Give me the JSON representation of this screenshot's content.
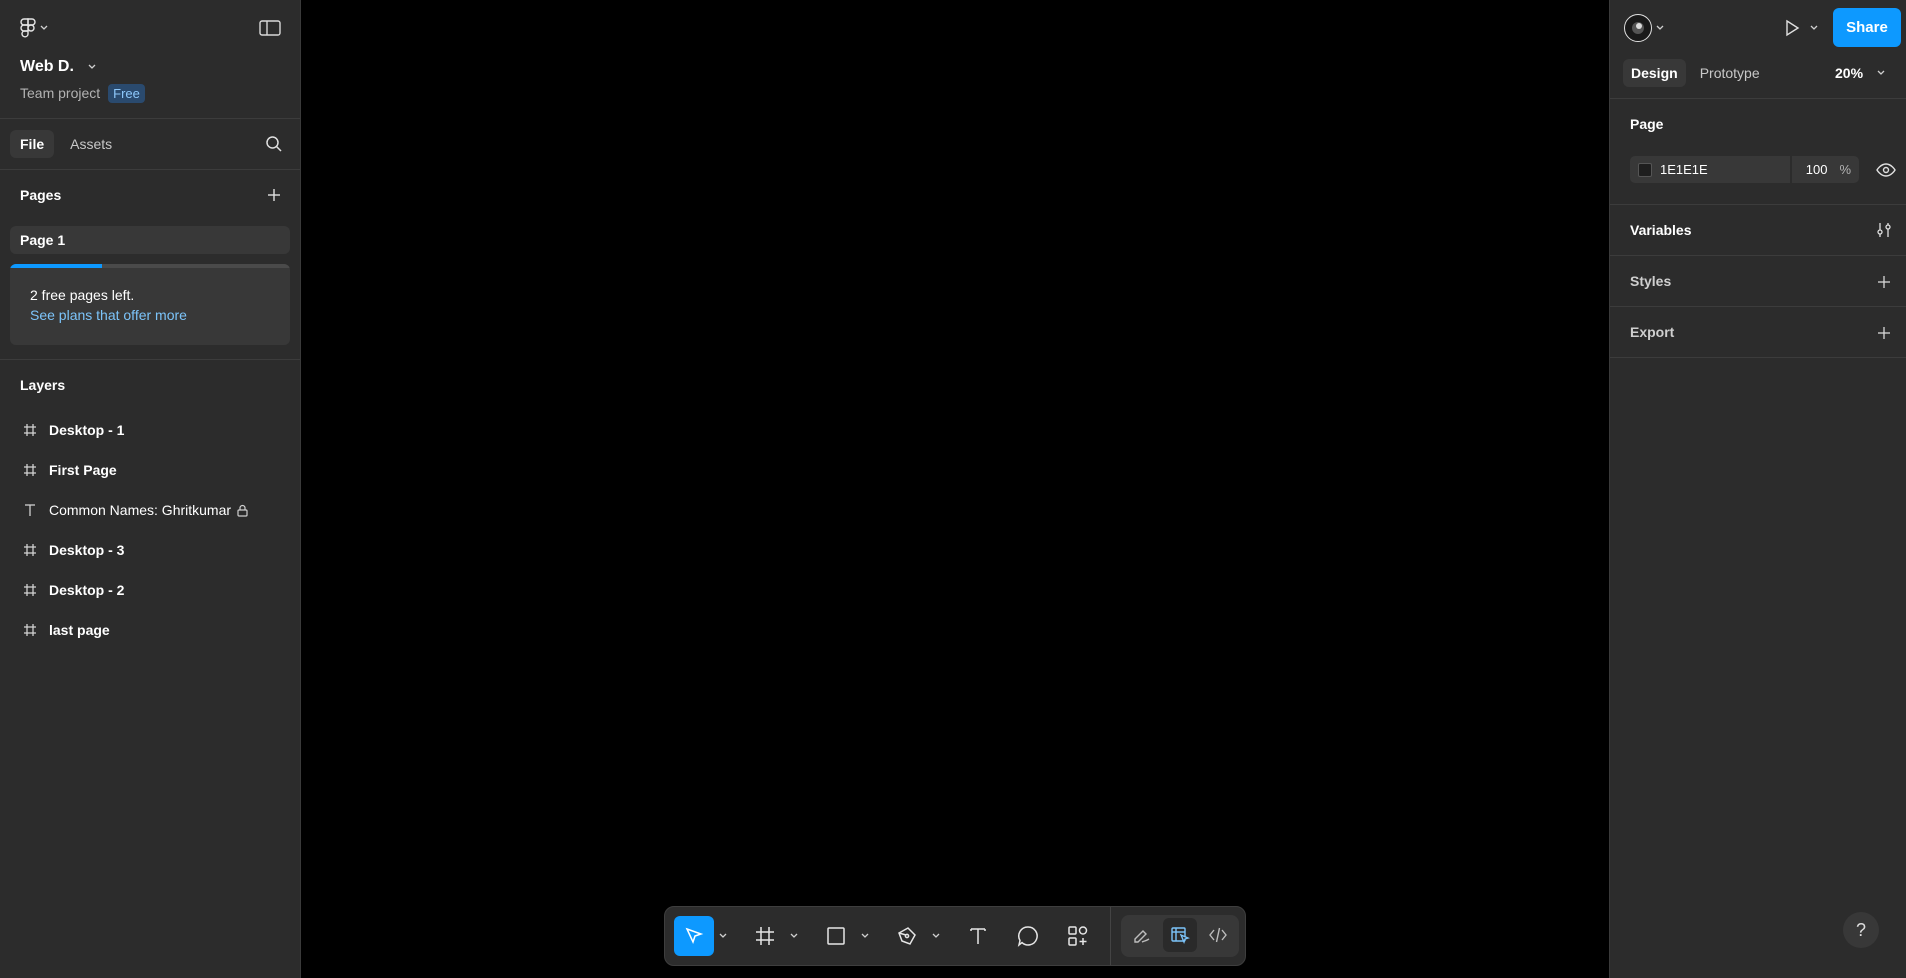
{
  "header": {
    "file_name": "Web D.",
    "project": "Team project",
    "plan_badge": "Free"
  },
  "left_tabs": {
    "file": "File",
    "assets": "Assets"
  },
  "pages": {
    "title": "Pages",
    "items": [
      "Page 1"
    ],
    "promo_line1": "2 free pages left.",
    "promo_link": "See plans that offer more",
    "promo_progress": 0.33
  },
  "layers": {
    "title": "Layers",
    "items": [
      {
        "name": "Desktop - 1",
        "kind": "frame"
      },
      {
        "name": "First Page",
        "kind": "frame"
      },
      {
        "name": "Common Names: Ghritkumar",
        "kind": "text",
        "locked": true
      },
      {
        "name": "Desktop - 3",
        "kind": "frame"
      },
      {
        "name": "Desktop - 2",
        "kind": "frame"
      },
      {
        "name": "last page",
        "kind": "frame"
      }
    ]
  },
  "right": {
    "share": "Share",
    "tabs": {
      "design": "Design",
      "prototype": "Prototype"
    },
    "zoom": "20%",
    "page_section": "Page",
    "bg_color": "1E1E1E",
    "bg_opacity": "100",
    "percent": "%",
    "variables": "Variables",
    "styles": "Styles",
    "export": "Export",
    "help": "?"
  },
  "colors": {
    "panel": "#2c2c2c",
    "canvas": "#000000",
    "accent": "#0d99ff",
    "link": "#7cc4fa"
  },
  "toolbar": {
    "tools": [
      "move-tool",
      "frame-tool",
      "rectangle-tool",
      "pen-tool",
      "text-tool",
      "comment-tool",
      "actions-tool"
    ],
    "modes": [
      "draw-mode",
      "design-mode",
      "dev-mode"
    ],
    "selected": "move-tool"
  }
}
